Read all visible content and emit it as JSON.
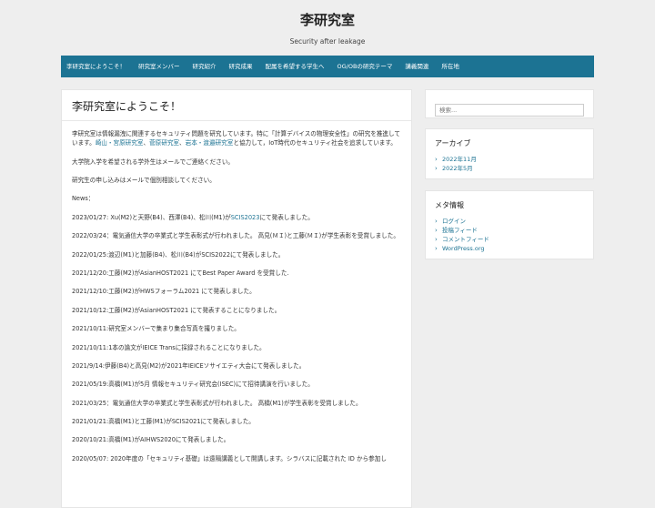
{
  "site": {
    "title": "李研究室",
    "tagline": "Security after leakage"
  },
  "nav": [
    "李研究室にようこそ！",
    "研究室メンバー",
    "研究紹介",
    "研究成果",
    "配属を希望する学生へ",
    "OG/OBの研究テーマ",
    "講義関連",
    "所在地"
  ],
  "post": {
    "title": "李研究室にようこそ！",
    "intro_a": "李研究室は情報漏洩に関連するセキュリティ問題を研究しています。特に「計算デバイスの物理安全性」の研究を推進しています。",
    "link1": "崎山・宮原研究室",
    "sep1": "、",
    "link2": "菅原研究室",
    "sep2": "、",
    "link3": "岩本・渡邉研究室",
    "intro_b": "と協力して，IoT時代のセキュリティ社会を追求しています。",
    "p2": "大学院入学を希望される学外生はメールでご連絡ください。",
    "p3": "研究生の申し込みはメールで個別相談してください。",
    "news_label": "News：",
    "news1_a": "2023/01/27: Xu(M2)と天野(B4)、西澤(B4)、松川(M1)が",
    "news1_link": "SCIS2023",
    "news1_b": "にて発表しました。",
    "news2": "2022/03/24：電気通信大学の卒業式と学生表彰式が行われました。 高見(ＭＩ)と工藤(ＭＩ)が学生表彰を受賞しました。",
    "news3": "2022/01/25:渡辺(M1)と加藤(B4)、松川(B4)がSCIS2022にて発表しました。",
    "news4": "2021/12/20:工藤(M2)がAsianHOST2021 にてBest Paper Award を受賞した.",
    "news5": "2021/12/10:工藤(M2)がHWSフォーラム2021 にて発表しました。",
    "news6": "2021/10/12:工藤(M2)がAsianHOST2021 にて発表することになりました。",
    "news7": "2021/10/11:研究室メンバーで集まり集合写真を撮りました。",
    "news8": "2021/10/11:1本の論文がIEICE Transに採録されることになりました。",
    "news9": "2021/9/14:伊藤(B4)と高見(M2)が2021年IEICEソサイエティ大会にて発表しました。",
    "news10": "2021/05/19:高橋(M1)が5月 情報セキュリティ研究会(ISEC)にて招待講演を行いました。",
    "news11": "2021/03/25：電気通信大学の卒業式と学生表彰式が行われました。 高橋(M1)が学生表彰を受賞しました。",
    "news12": "2021/01/21:高橋(M1)と工藤(M1)がSCIS2021にて発表しました。",
    "news13": "2020/10/21:高橋(M1)がAIHWS2020にて発表しました。",
    "news14": "2020/05/07: 2020年度の「セキュリティ基礎」は遠隔講義として開講します。シラバスに記載された ID から参加し"
  },
  "sidebar": {
    "search_placeholder": "検索...",
    "archive_title": "アーカイブ",
    "archive_items": [
      "2022年11月",
      "2022年5月"
    ],
    "meta_title": "メタ情報",
    "meta_items": [
      "ログイン",
      "投稿フィード",
      "コメントフィード",
      "WordPress.org"
    ]
  },
  "icons": {
    "list_bullet": "chevron-right-icon"
  },
  "colors": {
    "accent": "#1c7393",
    "background": "#eeeeee"
  }
}
